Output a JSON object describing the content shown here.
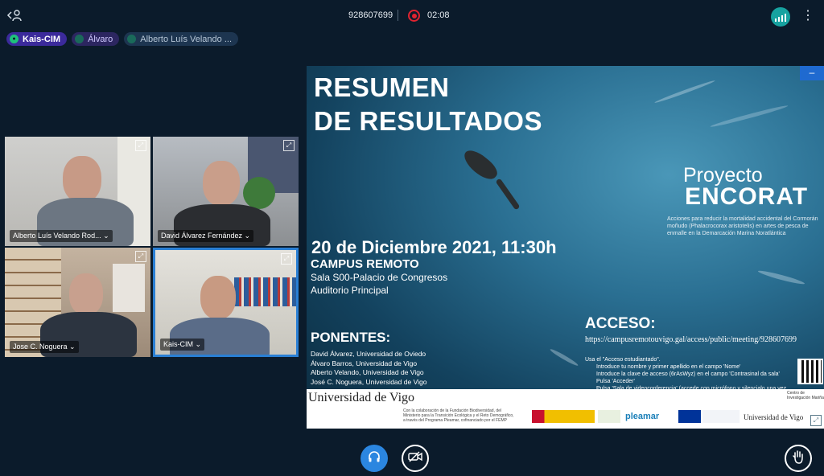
{
  "header": {
    "meeting_id": "928607699",
    "timer": "02:08",
    "leave_icon": "person-leave-icon",
    "more_icon": "kebab-menu-icon"
  },
  "talking": [
    {
      "name": "Kais-CIM"
    },
    {
      "name": "Álvaro"
    },
    {
      "name": "Alberto Luís Velando ..."
    }
  ],
  "tiles": [
    {
      "name": "Alberto Luís Velando Rod... ⌄"
    },
    {
      "name": "David Álvarez Fernández ⌄"
    },
    {
      "name": "Jose C. Noguera ⌄"
    },
    {
      "name": "Kais-CIM ⌄"
    }
  ],
  "slide": {
    "title_line1": "RESUMEN",
    "title_line2": "DE RESULTADOS",
    "proyecto": "Proyecto",
    "encorat": "ENCORAT",
    "description": "Acciones para reducir la mortalidad accidental del Cormorán moñudo (Phalacrocorax aristotelis) en artes de pesca de enmalle en la Demarcación Marina Noratlántica",
    "date": "20 de Diciembre 2021, 11:30h",
    "campus": "CAMPUS REMOTO",
    "sala": "Sala S00-Palacio de Congresos",
    "auditorio": "Auditorio Principal",
    "ponentes_title": "PONENTES:",
    "ponentes": [
      "David Álvarez, Universidad de Oviedo",
      "Álvaro Barros, Universidad de Vigo",
      "Alberto Velando, Universidad de Vigo",
      "José C. Noguera, Universidad de Vigo"
    ],
    "acceso_title": "ACCESO:",
    "acceso_url": "https://campusremotouvigo.gal/access/public/meeting/928607699",
    "instructions": [
      "Usa el \"Acceso estudiantado\".",
      "Introduce tu nombre y primer apellido en el campo 'Nome'",
      "Introduce la clave de acceso (6rAsWyz) en el campo 'Contrasinal da sala'",
      "Pulsa 'Acceder'",
      "Pulsa 'Sala de videoconferencia' (accede con micrófono y silencialo una vez dentro)"
    ],
    "footer_university": "Universidad de Vigo",
    "footer_note": "Con la colaboración de la Fundación Biodiversidad, del Ministerio para la Transición Ecológica y el Reto Demográfico, a través del Programa Pleamar, cofinanciado por el FEMP",
    "footer_pleamar": "pleamar",
    "footer_uvigo_small": "Universidad de Vigo",
    "footer_cim": "Centro de Investigación Mariña"
  },
  "controls": {
    "audio_icon": "headphones-icon",
    "video_icon": "camera-off-icon",
    "hand_icon": "raise-hand-icon"
  },
  "colors": {
    "background": "#0b1b2b",
    "accent": "#2b86e0",
    "record": "#e02330",
    "signal": "#17a2a0"
  }
}
